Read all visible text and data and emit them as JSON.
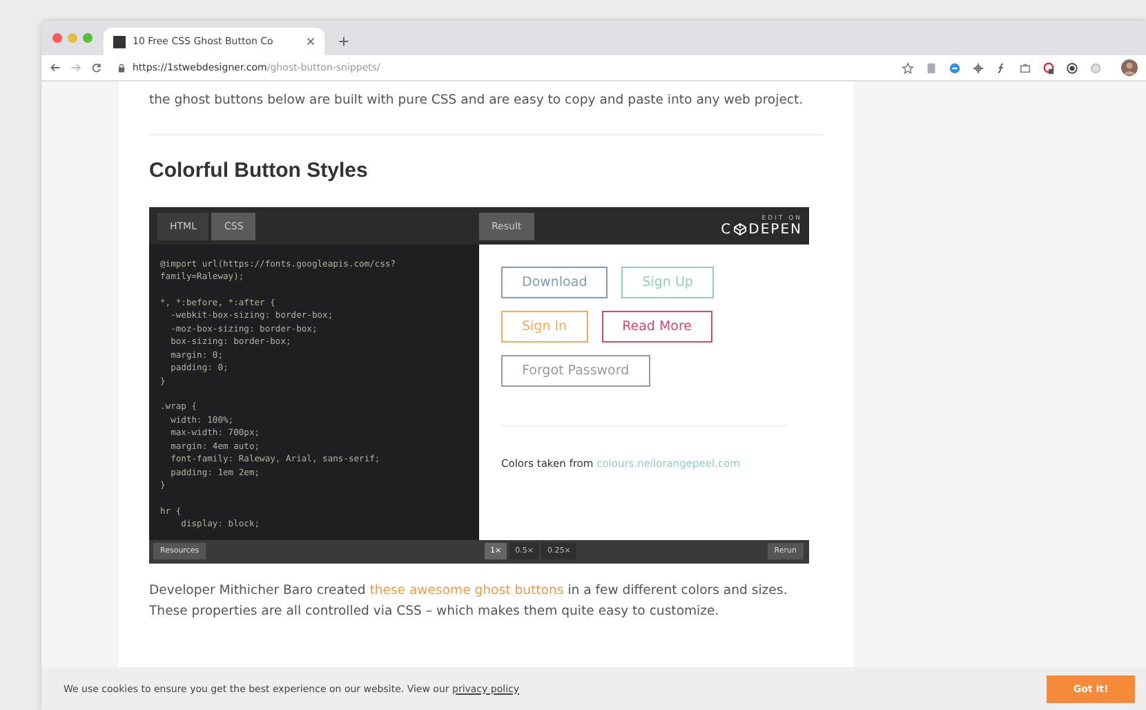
{
  "browser": {
    "tab_title": "10 Free CSS Ghost Button Co",
    "url_host": "https://1stwebdesigner.com",
    "url_path": "/ghost-button-snippets/"
  },
  "article": {
    "intro": "the ghost buttons below are built with pure CSS and are easy to copy and paste into any web project.",
    "heading": "Colorful Button Styles",
    "embed": {
      "editor_tabs": [
        {
          "label": "HTML",
          "selected": false
        },
        {
          "label": "CSS",
          "selected": true
        }
      ],
      "result_tab": "Result",
      "logo_top": "EDIT ON",
      "logo_left": "C",
      "logo_right": "DEPEN",
      "code_blocks": [
        [
          "@import url(https://fonts.googleapis.com/css?",
          "family=Raleway);"
        ],
        [
          "*, *:before, *:after {",
          "  -webkit-box-sizing: border-box;",
          "  -moz-box-sizing: border-box;",
          "  box-sizing: border-box;",
          "  margin: 0;",
          "  padding: 0;",
          "}"
        ],
        [
          ".wrap {",
          "  width: 100%;",
          "  max-width: 700px;",
          "  margin: 4em auto;",
          "  font-family: Raleway, Arial, sans-serif;",
          "  padding: 1em 2em;",
          "}"
        ],
        [
          "hr {",
          "    display: block;"
        ]
      ],
      "demo_buttons": [
        [
          {
            "label": "Download",
            "color": "#7c9cc0"
          },
          {
            "label": "Sign Up",
            "color": "#8fd1b4"
          }
        ],
        [
          {
            "label": "Sign In",
            "color": "#f7a859"
          },
          {
            "label": "Read More",
            "color": "#d9486a"
          }
        ],
        [
          {
            "label": "Forgot Password",
            "color": "#9a9a9a"
          }
        ]
      ],
      "note": "Colors taken from ",
      "note_link": "colours.neilorangepeel.com",
      "resources": "Resources",
      "zooms": [
        {
          "label": "1×",
          "selected": true
        },
        {
          "label": "0.5×",
          "selected": false
        },
        {
          "label": "0.25×",
          "selected": false
        }
      ],
      "rerun": "Rerun"
    },
    "outro_before": "Developer Mithicher Baro created ",
    "outro_link": "these awesome ghost buttons",
    "outro_after": " in a few different colors and sizes. These properties are all controlled via CSS – which makes them quite easy to customize."
  },
  "cookie_bar": {
    "text": "We use cookies to ensure you get the best experience on our website. View our ",
    "link": "privacy policy",
    "button": "Got it!"
  }
}
